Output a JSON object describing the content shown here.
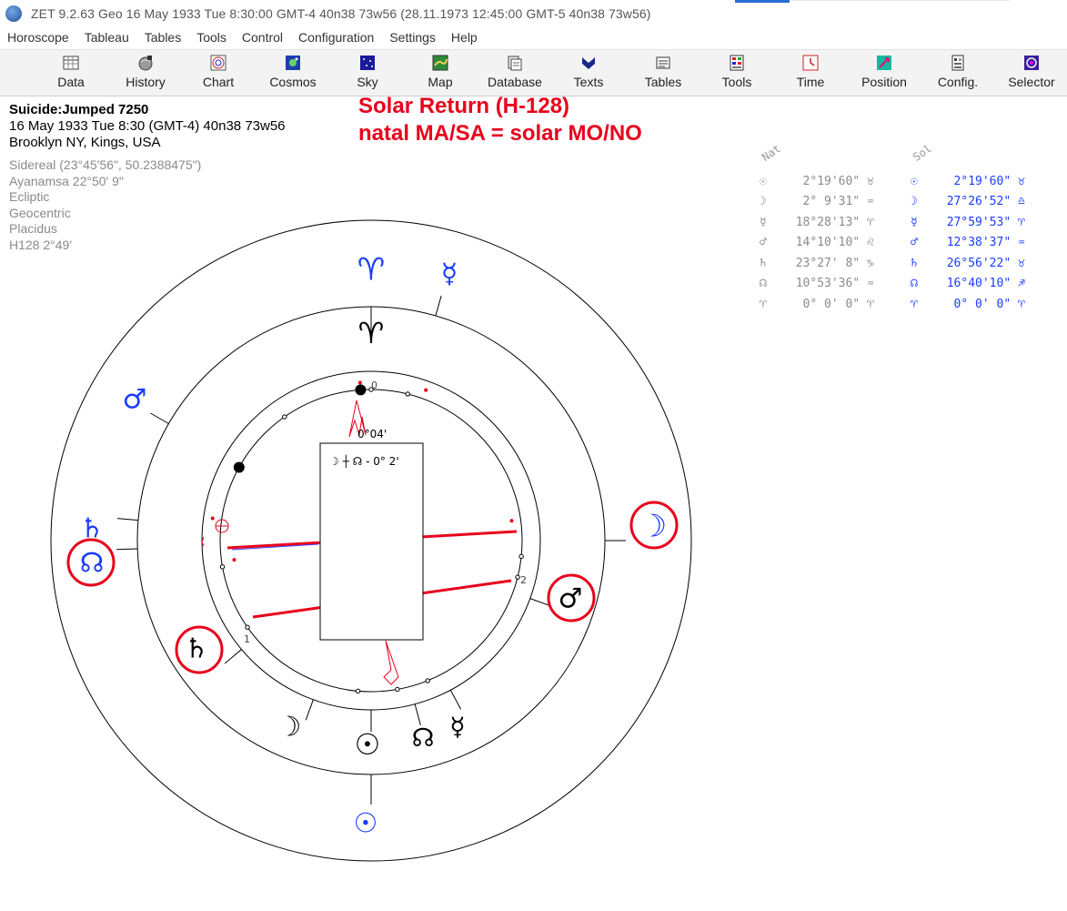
{
  "window": {
    "title": "ZET 9.2.63 Geo    16 May 1933  Tue    8:30:00 GMT-4 40n38  73w56   (28.11.1973  12:45:00 GMT-5 40n38 73w56)"
  },
  "menu": [
    "Horoscope",
    "Tableau",
    "Tables",
    "Tools",
    "Control",
    "Configuration",
    "Settings",
    "Help"
  ],
  "toolbar": [
    {
      "label": "Data",
      "icon": "data-grid-icon"
    },
    {
      "label": "History",
      "icon": "history-globe-icon"
    },
    {
      "label": "Chart",
      "icon": "chart-wheel-icon"
    },
    {
      "label": "Cosmos",
      "icon": "cosmos-icon"
    },
    {
      "label": "Sky",
      "icon": "sky-stars-icon"
    },
    {
      "label": "Map",
      "icon": "map-icon"
    },
    {
      "label": "Database",
      "icon": "database-icon"
    },
    {
      "label": "Texts",
      "icon": "texts-icon"
    },
    {
      "label": "Tables",
      "icon": "tables-icon"
    },
    {
      "label": "Tools",
      "icon": "tools-icon"
    },
    {
      "label": "Time",
      "icon": "time-icon"
    },
    {
      "label": "Position",
      "icon": "position-icon"
    },
    {
      "label": "Config.",
      "icon": "config-icon"
    },
    {
      "label": "Selector",
      "icon": "selector-icon"
    }
  ],
  "info": {
    "name": "Suicide:Jumped 7250",
    "date_line": "16 May 1933  Tue   8:30 (GMT-4) 40n38  73w56",
    "place": "Brooklyn NY, Kings, USA",
    "settings": [
      "Sidereal (23°45'56\", 50.2388475\")",
      "Ayanamsa 22°50' 9\"",
      "Ecliptic",
      "Geocentric",
      "Placidus",
      "H128   2°49'"
    ]
  },
  "headline": {
    "line1": "Solar Return (H-128)",
    "line2": "natal MA/SA = solar MO/NO"
  },
  "positions": {
    "nat_header": "Nat",
    "sol_header": "Sol",
    "rows": [
      {
        "nat_glyph": "☉",
        "nat": "2°19'60\"",
        "nat_sign": "♉",
        "sol_glyph": "☉",
        "sol": "2°19'60\"",
        "sol_sign": "♉"
      },
      {
        "nat_glyph": "☽",
        "nat": "2° 9'31\"",
        "nat_sign": "♒",
        "sol_glyph": "☽",
        "sol": "27°26'52\"",
        "sol_sign": "♎"
      },
      {
        "nat_glyph": "☿",
        "nat": "18°28'13\"",
        "nat_sign": "♈",
        "sol_glyph": "☿",
        "sol": "27°59'53\"",
        "sol_sign": "♈"
      },
      {
        "nat_glyph": "♂",
        "nat": "14°10'10\"",
        "nat_sign": "♌",
        "sol_glyph": "♂",
        "sol": "12°38'37\"",
        "sol_sign": "♒"
      },
      {
        "nat_glyph": "♄",
        "nat": "23°27' 8\"",
        "nat_sign": "♑",
        "sol_glyph": "♄",
        "sol": "26°56'22\"",
        "sol_sign": "♉"
      },
      {
        "nat_glyph": "☊",
        "nat": "10°53'36\"",
        "nat_sign": "♒",
        "sol_glyph": "☊",
        "sol": "16°40'10\"",
        "sol_sign": "♐"
      },
      {
        "nat_glyph": "♈",
        "nat": "0° 0' 0\"",
        "nat_sign": "♈",
        "sol_glyph": "♈",
        "sol": "0° 0' 0\"",
        "sol_sign": "♈"
      }
    ]
  },
  "chart": {
    "center_box_text": "☽ ┼ ☊ - 0° 2'",
    "pointer_label": "0°04'",
    "small_labels": [
      "0",
      "1",
      "2"
    ],
    "outer_glyphs": [
      {
        "glyph": "♈",
        "color": "#1a3cff",
        "name": "aries-sol-glyph"
      },
      {
        "glyph": "☿",
        "color": "#1a3cff",
        "name": "mercury-sol-glyph"
      },
      {
        "glyph": "♂",
        "color": "#1a3cff",
        "name": "mars-sol-glyph"
      },
      {
        "glyph": "♄",
        "color": "#1a3cff",
        "name": "saturn-sol-glyph"
      },
      {
        "glyph": "☊",
        "color": "#1a3cff",
        "name": "node-sol-glyph"
      },
      {
        "glyph": "☽",
        "color": "#1a3cff",
        "name": "moon-sol-glyph"
      },
      {
        "glyph": "☉",
        "color": "#1a3cff",
        "name": "sun-sol-glyph"
      }
    ],
    "inner_glyphs": [
      {
        "glyph": "♈",
        "color": "#000000",
        "name": "aries-nat-glyph"
      },
      {
        "glyph": "♂",
        "color": "#000000",
        "name": "mars-nat-glyph"
      },
      {
        "glyph": "♄",
        "color": "#000000",
        "name": "saturn-nat-glyph"
      },
      {
        "glyph": "☽",
        "color": "#000000",
        "name": "moon-nat-glyph"
      },
      {
        "glyph": "☉",
        "color": "#000000",
        "name": "sun-nat-glyph"
      },
      {
        "glyph": "☊",
        "color": "#000000",
        "name": "node-nat-glyph"
      },
      {
        "glyph": "☿",
        "color": "#000000",
        "name": "mercury-nat-glyph"
      }
    ],
    "colors": {
      "accent_red": "#e8001c",
      "sol_blue": "#1a3cff"
    }
  }
}
